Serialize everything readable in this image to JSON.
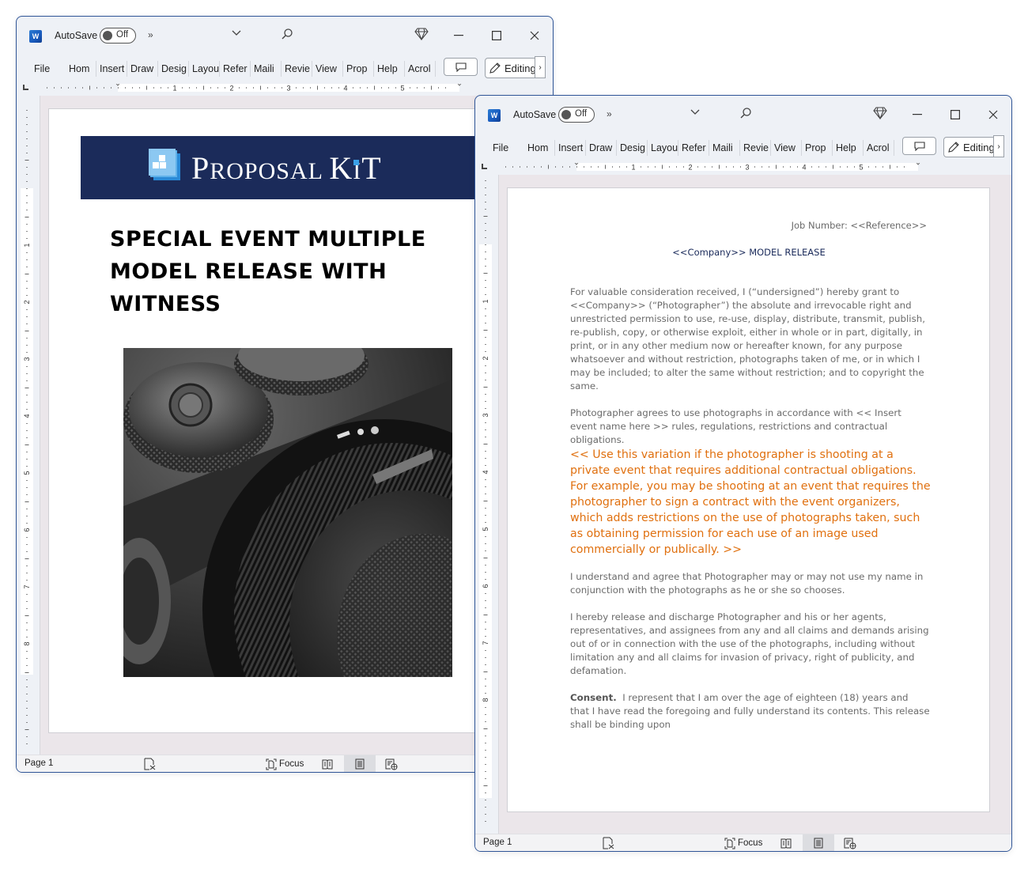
{
  "windows": [
    {
      "app": "Word",
      "autosave_label": "AutoSave",
      "autosave_state": "Off",
      "ribbon_tabs": [
        "File",
        "Hom",
        "Insert",
        "Draw",
        "Desig",
        "Layou",
        "Refer",
        "Maili",
        "Revie",
        "View",
        "Prop",
        "Help",
        "Acrol"
      ],
      "editing_label": "Editing",
      "ruler_numbers": [
        "1",
        "2",
        "3",
        "4",
        "5"
      ],
      "vruler_numbers": [
        "1",
        "2",
        "3",
        "4",
        "5",
        "6",
        "7",
        "8"
      ],
      "status": {
        "page": "Page 1",
        "focus": "Focus"
      },
      "document": {
        "banner_brand": "Proposal Kit",
        "banner_brand_parts": [
          "P",
          "ROPOSAL ",
          "K",
          "I",
          "T"
        ],
        "cover_title": "SPECIAL EVENT MULTIPLE MODEL RELEASE WITH WITNESS",
        "cover_image": "camera-closeup-photo"
      }
    },
    {
      "app": "Word",
      "autosave_label": "AutoSave",
      "autosave_state": "Off",
      "ribbon_tabs": [
        "File",
        "Hom",
        "Insert",
        "Draw",
        "Desig",
        "Layou",
        "Refer",
        "Maili",
        "Revie",
        "View",
        "Prop",
        "Help",
        "Acrol"
      ],
      "editing_label": "Editing",
      "ruler_numbers": [
        "1",
        "2",
        "3",
        "4",
        "5"
      ],
      "vruler_numbers": [
        "1",
        "2",
        "3",
        "4",
        "5",
        "6",
        "7",
        "8"
      ],
      "status": {
        "page": "Page 1",
        "focus": "Focus"
      },
      "document": {
        "job_number": "Job Number: <<Reference>>",
        "title": "<<Company>> MODEL RELEASE",
        "paragraphs": [
          "For valuable consideration received, I (“undersigned”) hereby grant to <<Company>> (“Photographer”) the absolute and irrevocable right and unrestricted permission to use, re-use, display, distribute, transmit, publish, re-publish, copy, or otherwise exploit, either in whole or in part, digitally, in print, or in any other medium now or hereafter known, for any purpose whatsoever and without restriction, photographs taken of me, or in which I may be included; to alter the same without restriction; and to copyright the same.",
          "Photographer agrees to use photographs in accordance with << Insert event name here >> rules, regulations, restrictions and contractual obligations."
        ],
        "instruction_note": "<< Use this variation if the photographer is shooting at a private event that requires additional contractual obligations. For example, you may be shooting at an event that requires the photographer to sign a contract with the event organizers, which adds restrictions on the use of photographs taken, such as obtaining permission for each use of an image used commercially or publically. >>",
        "paragraphs_after": [
          "I understand and agree that Photographer may or may not use my name in conjunction with the photographs as he or she so chooses.",
          "I hereby release and discharge Photographer and his or her agents, representatives, and assignees from any and all claims and demands arising out of or in connection with the use of the photographs, including without limitation any and all claims for invasion of privacy, right of publicity, and defamation."
        ],
        "consent_label": "Consent.",
        "consent_text": "I represent that I am over the age of eighteen (18) years and that I have read the foregoing and fully understand its contents. This release shall be binding upon"
      }
    }
  ],
  "colors": {
    "word_blue": "#185abd",
    "window_border": "#2f5597",
    "banner_navy": "#1b2b5a",
    "instruction_orange": "#e0700f",
    "body_gray": "#6b6b6b"
  }
}
